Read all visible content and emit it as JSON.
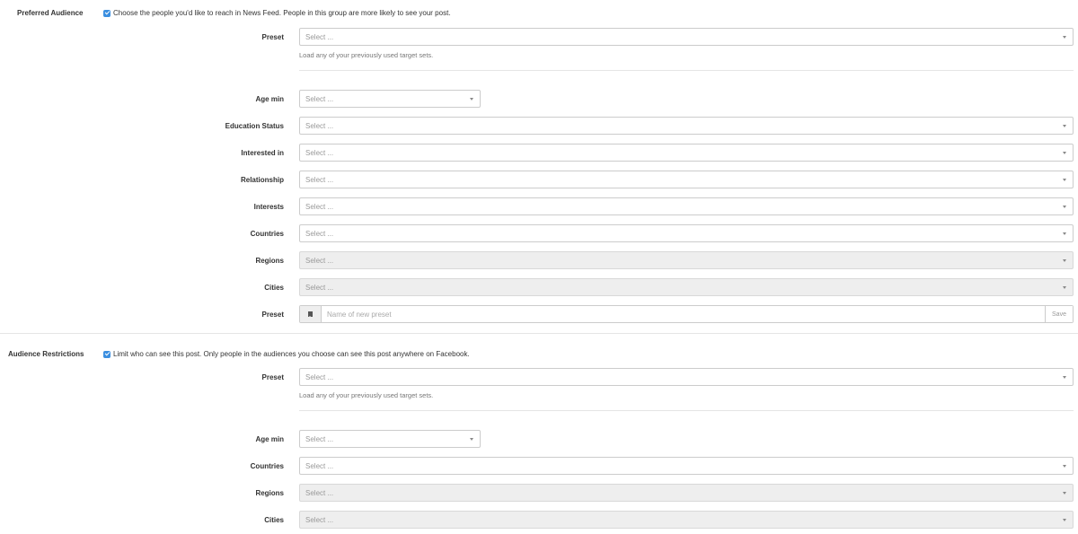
{
  "preferred": {
    "title": "Preferred Audience",
    "checkbox_text": "Choose the people you'd like to reach in News Feed. People in this group are more likely to see your post.",
    "preset_label": "Preset",
    "preset_placeholder": "Select ...",
    "preset_help": "Load any of your previously used target sets.",
    "fields": [
      {
        "label": "Age min",
        "placeholder": "Select ...",
        "disabled": false
      },
      {
        "label": "Education Status",
        "placeholder": "Select ...",
        "disabled": false
      },
      {
        "label": "Interested in",
        "placeholder": "Select ...",
        "disabled": false
      },
      {
        "label": "Relationship",
        "placeholder": "Select ...",
        "disabled": false
      },
      {
        "label": "Interests",
        "placeholder": "Select ...",
        "disabled": false
      },
      {
        "label": "Countries",
        "placeholder": "Select ...",
        "disabled": false
      },
      {
        "label": "Regions",
        "placeholder": "Select ...",
        "disabled": true
      },
      {
        "label": "Cities",
        "placeholder": "Select ...",
        "disabled": true
      }
    ],
    "new_preset_label": "Preset",
    "new_preset_placeholder": "Name of new preset",
    "save_label": "Save"
  },
  "restrictions": {
    "title": "Audience Restrictions",
    "checkbox_text": "Limit who can see this post. Only people in the audiences you choose can see this post anywhere on Facebook.",
    "preset_label": "Preset",
    "preset_placeholder": "Select ...",
    "preset_help": "Load any of your previously used target sets.",
    "fields": [
      {
        "label": "Age min",
        "placeholder": "Select ...",
        "disabled": false
      },
      {
        "label": "Countries",
        "placeholder": "Select ...",
        "disabled": false
      },
      {
        "label": "Regions",
        "placeholder": "Select ...",
        "disabled": true
      },
      {
        "label": "Cities",
        "placeholder": "Select ...",
        "disabled": true
      }
    ]
  },
  "icons": {
    "checkbox": "checkbox-checked-icon",
    "caret": "chevron-down-icon",
    "bookmark": "bookmark-icon"
  },
  "colors": {
    "checkbox": "#3b8fe0",
    "disabled_bg": "#eeeeee"
  }
}
